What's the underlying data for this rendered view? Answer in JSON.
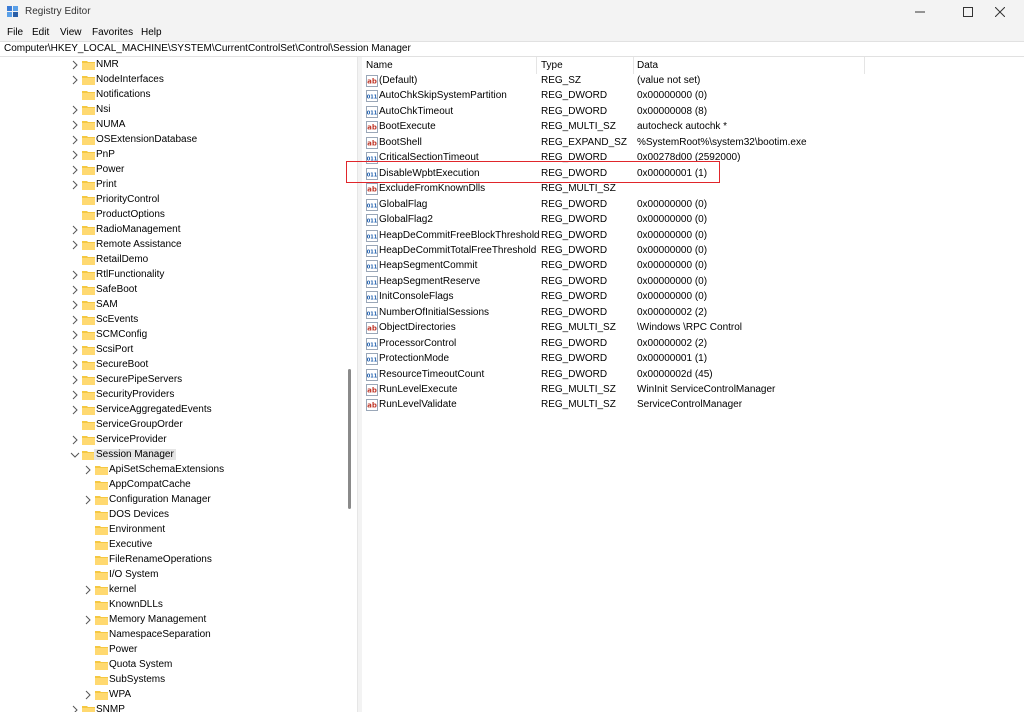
{
  "window": {
    "title": "Registry Editor"
  },
  "menu": {
    "items": [
      "File",
      "Edit",
      "View",
      "Favorites",
      "Help"
    ]
  },
  "address": {
    "path": "Computer\\HKEY_LOCAL_MACHINE\\SYSTEM\\CurrentControlSet\\Control\\Session Manager"
  },
  "tree": {
    "items": [
      {
        "label": "NMR",
        "expandable": true
      },
      {
        "label": "NodeInterfaces",
        "expandable": true
      },
      {
        "label": "Notifications",
        "expandable": false
      },
      {
        "label": "Nsi",
        "expandable": true
      },
      {
        "label": "NUMA",
        "expandable": true
      },
      {
        "label": "OSExtensionDatabase",
        "expandable": true
      },
      {
        "label": "PnP",
        "expandable": true
      },
      {
        "label": "Power",
        "expandable": true
      },
      {
        "label": "Print",
        "expandable": true
      },
      {
        "label": "PriorityControl",
        "expandable": false
      },
      {
        "label": "ProductOptions",
        "expandable": false
      },
      {
        "label": "RadioManagement",
        "expandable": true
      },
      {
        "label": "Remote Assistance",
        "expandable": true
      },
      {
        "label": "RetailDemo",
        "expandable": false
      },
      {
        "label": "RtlFunctionality",
        "expandable": true
      },
      {
        "label": "SafeBoot",
        "expandable": true
      },
      {
        "label": "SAM",
        "expandable": true
      },
      {
        "label": "ScEvents",
        "expandable": true
      },
      {
        "label": "SCMConfig",
        "expandable": true
      },
      {
        "label": "ScsiPort",
        "expandable": true
      },
      {
        "label": "SecureBoot",
        "expandable": true
      },
      {
        "label": "SecurePipeServers",
        "expandable": true
      },
      {
        "label": "SecurityProviders",
        "expandable": true
      },
      {
        "label": "ServiceAggregatedEvents",
        "expandable": true
      },
      {
        "label": "ServiceGroupOrder",
        "expandable": false
      },
      {
        "label": "ServiceProvider",
        "expandable": true
      },
      {
        "label": "Session Manager",
        "expandable": true,
        "expanded": true,
        "selected": true
      },
      {
        "label": "ApiSetSchemaExtensions",
        "expandable": true,
        "child": true
      },
      {
        "label": "AppCompatCache",
        "expandable": false,
        "child": true
      },
      {
        "label": "Configuration Manager",
        "expandable": true,
        "child": true
      },
      {
        "label": "DOS Devices",
        "expandable": false,
        "child": true
      },
      {
        "label": "Environment",
        "expandable": false,
        "child": true
      },
      {
        "label": "Executive",
        "expandable": false,
        "child": true
      },
      {
        "label": "FileRenameOperations",
        "expandable": false,
        "child": true
      },
      {
        "label": "I/O System",
        "expandable": false,
        "child": true
      },
      {
        "label": "kernel",
        "expandable": true,
        "child": true
      },
      {
        "label": "KnownDLLs",
        "expandable": false,
        "child": true
      },
      {
        "label": "Memory Management",
        "expandable": true,
        "child": true
      },
      {
        "label": "NamespaceSeparation",
        "expandable": false,
        "child": true
      },
      {
        "label": "Power",
        "expandable": false,
        "child": true
      },
      {
        "label": "Quota System",
        "expandable": false,
        "child": true
      },
      {
        "label": "SubSystems",
        "expandable": false,
        "child": true
      },
      {
        "label": "WPA",
        "expandable": true,
        "child": true
      },
      {
        "label": "SNMP",
        "expandable": true
      }
    ]
  },
  "list": {
    "columns": {
      "name": "Name",
      "type": "Type",
      "data": "Data"
    },
    "rows": [
      {
        "icon": "string-value-icon",
        "name": "(Default)",
        "type": "REG_SZ",
        "data": "(value not set)"
      },
      {
        "icon": "binary-value-icon",
        "name": "AutoChkSkipSystemPartition",
        "type": "REG_DWORD",
        "data": "0x00000000 (0)"
      },
      {
        "icon": "binary-value-icon",
        "name": "AutoChkTimeout",
        "type": "REG_DWORD",
        "data": "0x00000008 (8)"
      },
      {
        "icon": "string-value-icon",
        "name": "BootExecute",
        "type": "REG_MULTI_SZ",
        "data": "autocheck autochk *"
      },
      {
        "icon": "string-value-icon",
        "name": "BootShell",
        "type": "REG_EXPAND_SZ",
        "data": "%SystemRoot%\\system32\\bootim.exe"
      },
      {
        "icon": "binary-value-icon",
        "name": "CriticalSectionTimeout",
        "type": "REG_DWORD",
        "data": "0x00278d00 (2592000)"
      },
      {
        "icon": "binary-value-icon",
        "name": "DisableWpbtExecution",
        "type": "REG_DWORD",
        "data": "0x00000001 (1)"
      },
      {
        "icon": "string-value-icon",
        "name": "ExcludeFromKnownDlls",
        "type": "REG_MULTI_SZ",
        "data": ""
      },
      {
        "icon": "binary-value-icon",
        "name": "GlobalFlag",
        "type": "REG_DWORD",
        "data": "0x00000000 (0)"
      },
      {
        "icon": "binary-value-icon",
        "name": "GlobalFlag2",
        "type": "REG_DWORD",
        "data": "0x00000000 (0)"
      },
      {
        "icon": "binary-value-icon",
        "name": "HeapDeCommitFreeBlockThreshold",
        "type": "REG_DWORD",
        "data": "0x00000000 (0)"
      },
      {
        "icon": "binary-value-icon",
        "name": "HeapDeCommitTotalFreeThreshold",
        "type": "REG_DWORD",
        "data": "0x00000000 (0)"
      },
      {
        "icon": "binary-value-icon",
        "name": "HeapSegmentCommit",
        "type": "REG_DWORD",
        "data": "0x00000000 (0)"
      },
      {
        "icon": "binary-value-icon",
        "name": "HeapSegmentReserve",
        "type": "REG_DWORD",
        "data": "0x00000000 (0)"
      },
      {
        "icon": "binary-value-icon",
        "name": "InitConsoleFlags",
        "type": "REG_DWORD",
        "data": "0x00000000 (0)"
      },
      {
        "icon": "binary-value-icon",
        "name": "NumberOfInitialSessions",
        "type": "REG_DWORD",
        "data": "0x00000002 (2)"
      },
      {
        "icon": "string-value-icon",
        "name": "ObjectDirectories",
        "type": "REG_MULTI_SZ",
        "data": "\\Windows \\RPC Control"
      },
      {
        "icon": "binary-value-icon",
        "name": "ProcessorControl",
        "type": "REG_DWORD",
        "data": "0x00000002 (2)"
      },
      {
        "icon": "binary-value-icon",
        "name": "ProtectionMode",
        "type": "REG_DWORD",
        "data": "0x00000001 (1)"
      },
      {
        "icon": "binary-value-icon",
        "name": "ResourceTimeoutCount",
        "type": "REG_DWORD",
        "data": "0x0000002d (45)"
      },
      {
        "icon": "string-value-icon",
        "name": "RunLevelExecute",
        "type": "REG_MULTI_SZ",
        "data": "WinInit ServiceControlManager"
      },
      {
        "icon": "string-value-icon",
        "name": "RunLevelValidate",
        "type": "REG_MULTI_SZ",
        "data": "ServiceControlManager"
      }
    ]
  },
  "colors": {
    "highlight_box": "#e0262b",
    "folder": "#f5c842",
    "selected_bg": "#e5e5e5"
  }
}
